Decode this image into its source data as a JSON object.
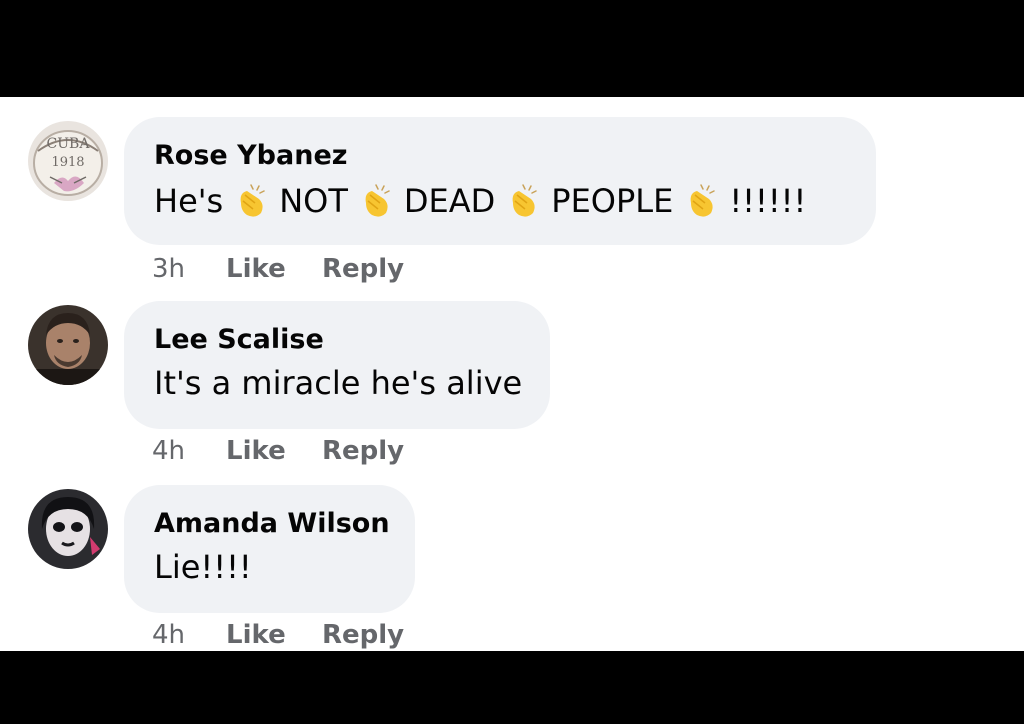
{
  "comments": [
    {
      "author": "Rose Ybanez",
      "text_parts": [
        "He's",
        "NOT",
        "DEAD",
        "PEOPLE",
        "!!!!!!"
      ],
      "emoji": "clapping-hands-icon",
      "time": "3h",
      "like_label": "Like",
      "reply_label": "Reply",
      "avatar_text": [
        "CUBA",
        "1918"
      ]
    },
    {
      "author": "Lee Scalise",
      "text": "It's a miracle he's alive",
      "time": "4h",
      "like_label": "Like",
      "reply_label": "Reply"
    },
    {
      "author": "Amanda Wilson",
      "text": "Lie!!!!",
      "time": "4h",
      "like_label": "Like",
      "reply_label": "Reply"
    }
  ],
  "colors": {
    "bubble": "#f0f2f5",
    "text": "#050505",
    "secondary": "#65676b",
    "letterbox": "#000000"
  }
}
